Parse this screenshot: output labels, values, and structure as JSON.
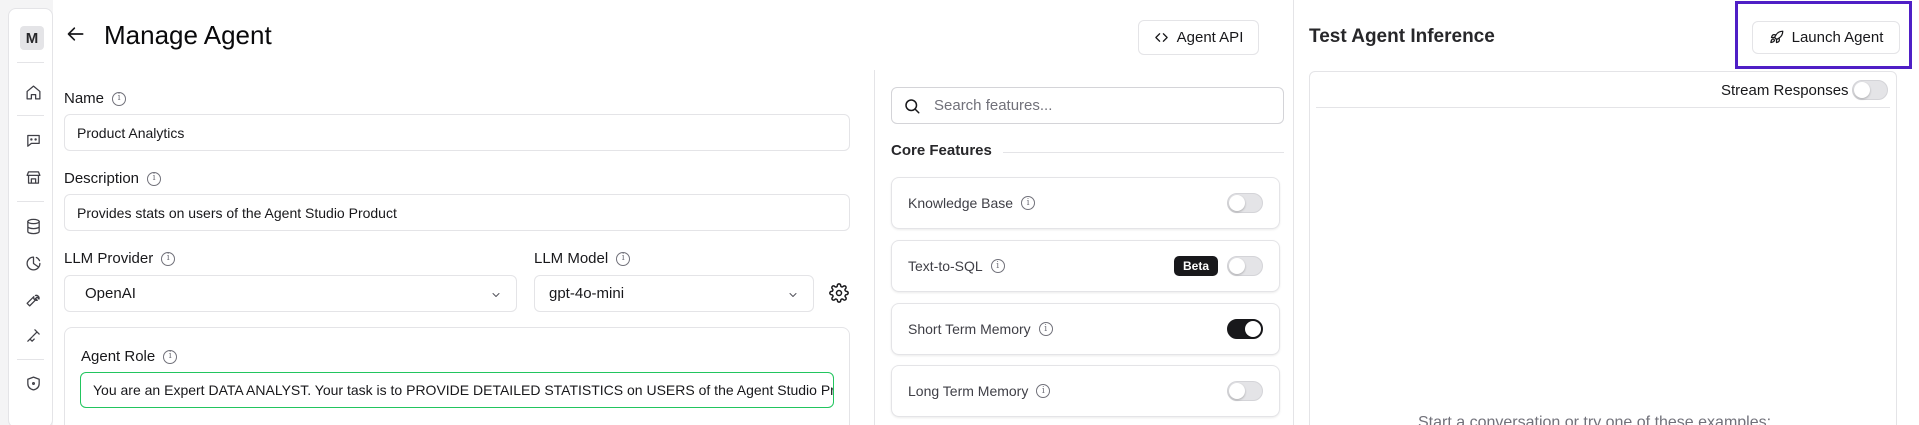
{
  "sidebar": {
    "avatar_letter": "M",
    "icons": [
      "home-icon",
      "chat-bot-icon",
      "store-icon",
      "database-icon",
      "analytics-icon",
      "wrench-icon",
      "integrations-icon",
      "shield-icon"
    ]
  },
  "header": {
    "title": "Manage Agent",
    "agent_api_label": "Agent API"
  },
  "form": {
    "name_label": "Name",
    "name_value": "Product Analytics",
    "description_label": "Description",
    "description_value": "Provides stats on users of the Agent Studio Product",
    "llm_provider_label": "LLM Provider",
    "llm_provider_value": "OpenAI",
    "llm_model_label": "LLM Model",
    "llm_model_value": "gpt-4o-mini",
    "agent_role_label": "Agent Role",
    "agent_role_value": "You are an Expert DATA ANALYST. Your task is to PROVIDE DETAILED STATISTICS on USERS of the Agent Studio Product"
  },
  "features": {
    "search_placeholder": "Search features...",
    "section_title": "Core Features",
    "items": [
      {
        "label": "Knowledge Base",
        "enabled": false
      },
      {
        "label": "Text-to-SQL",
        "badge": "Beta",
        "enabled": false
      },
      {
        "label": "Short Term Memory",
        "enabled": true
      },
      {
        "label": "Long Term Memory",
        "enabled": false
      }
    ]
  },
  "test": {
    "title": "Test Agent Inference",
    "launch_label": "Launch Agent",
    "stream_label": "Stream Responses",
    "stream_enabled": false,
    "hint": "Start a conversation or try one of these examples:"
  },
  "colors": {
    "highlight": "#4f1fc6",
    "role_border": "#22c55e",
    "toggle_on": "#18181b"
  }
}
